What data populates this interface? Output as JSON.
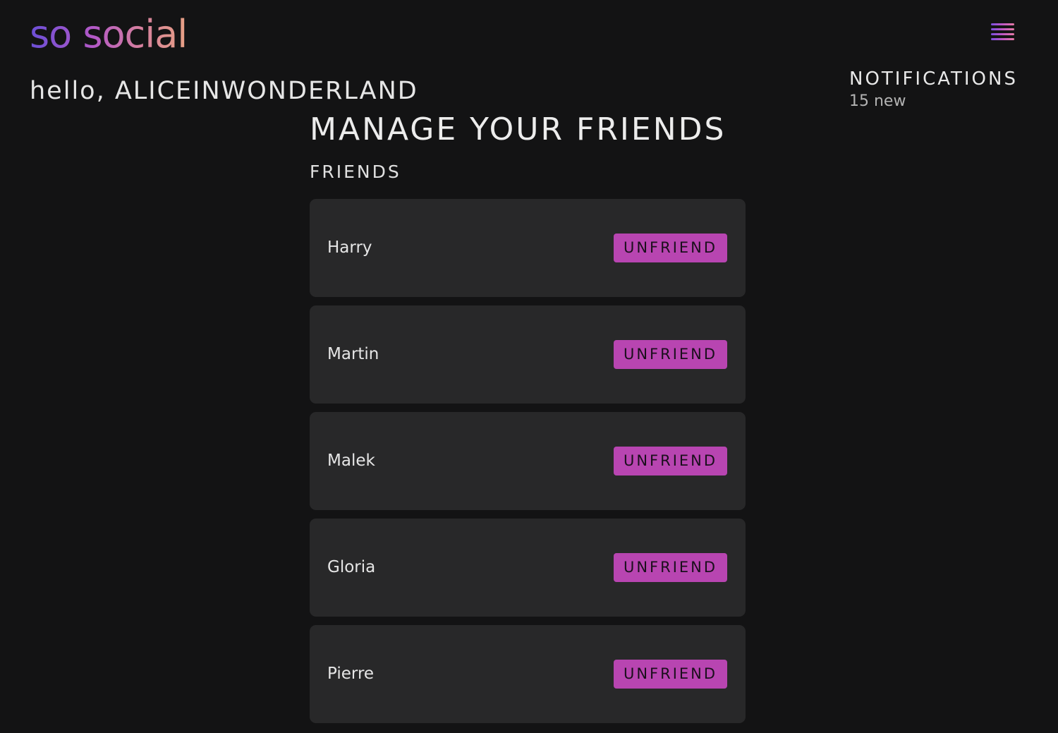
{
  "app": {
    "logo_text": "so social",
    "brand_gradient": [
      "#6b4fd6",
      "#b258c7",
      "#d57f9f",
      "#e7a084"
    ]
  },
  "header": {
    "menu_icon": "hamburger-menu-icon"
  },
  "greeting": "hello, ALICEINWONDERLAND",
  "notifications": {
    "title": "NOTIFICATIONS",
    "count_text": "15 new"
  },
  "main": {
    "title": "MANAGE YOUR FRIENDS",
    "section_title": "FRIENDS",
    "friends": [
      {
        "name": "Harry",
        "action_label": "UNFRIEND"
      },
      {
        "name": "Martin",
        "action_label": "UNFRIEND"
      },
      {
        "name": "Malek",
        "action_label": "UNFRIEND"
      },
      {
        "name": "Gloria",
        "action_label": "UNFRIEND"
      },
      {
        "name": "Pierre",
        "action_label": "UNFRIEND"
      }
    ]
  },
  "colors": {
    "background": "#131314",
    "card": "#282829",
    "button": "#b845b1"
  }
}
